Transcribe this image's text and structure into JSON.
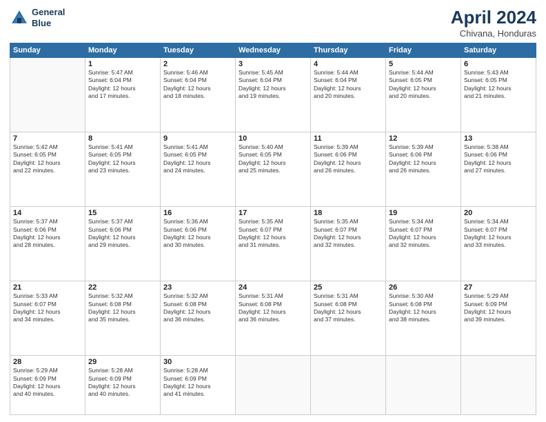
{
  "header": {
    "logo_line1": "General",
    "logo_line2": "Blue",
    "month": "April 2024",
    "location": "Chivana, Honduras"
  },
  "weekdays": [
    "Sunday",
    "Monday",
    "Tuesday",
    "Wednesday",
    "Thursday",
    "Friday",
    "Saturday"
  ],
  "weeks": [
    [
      {
        "day": "",
        "info": ""
      },
      {
        "day": "1",
        "info": "Sunrise: 5:47 AM\nSunset: 6:04 PM\nDaylight: 12 hours\nand 17 minutes."
      },
      {
        "day": "2",
        "info": "Sunrise: 5:46 AM\nSunset: 6:04 PM\nDaylight: 12 hours\nand 18 minutes."
      },
      {
        "day": "3",
        "info": "Sunrise: 5:45 AM\nSunset: 6:04 PM\nDaylight: 12 hours\nand 19 minutes."
      },
      {
        "day": "4",
        "info": "Sunrise: 5:44 AM\nSunset: 6:04 PM\nDaylight: 12 hours\nand 20 minutes."
      },
      {
        "day": "5",
        "info": "Sunrise: 5:44 AM\nSunset: 6:05 PM\nDaylight: 12 hours\nand 20 minutes."
      },
      {
        "day": "6",
        "info": "Sunrise: 5:43 AM\nSunset: 6:05 PM\nDaylight: 12 hours\nand 21 minutes."
      }
    ],
    [
      {
        "day": "7",
        "info": "Sunrise: 5:42 AM\nSunset: 6:05 PM\nDaylight: 12 hours\nand 22 minutes."
      },
      {
        "day": "8",
        "info": "Sunrise: 5:41 AM\nSunset: 6:05 PM\nDaylight: 12 hours\nand 23 minutes."
      },
      {
        "day": "9",
        "info": "Sunrise: 5:41 AM\nSunset: 6:05 PM\nDaylight: 12 hours\nand 24 minutes."
      },
      {
        "day": "10",
        "info": "Sunrise: 5:40 AM\nSunset: 6:05 PM\nDaylight: 12 hours\nand 25 minutes."
      },
      {
        "day": "11",
        "info": "Sunrise: 5:39 AM\nSunset: 6:06 PM\nDaylight: 12 hours\nand 26 minutes."
      },
      {
        "day": "12",
        "info": "Sunrise: 5:39 AM\nSunset: 6:06 PM\nDaylight: 12 hours\nand 26 minutes."
      },
      {
        "day": "13",
        "info": "Sunrise: 5:38 AM\nSunset: 6:06 PM\nDaylight: 12 hours\nand 27 minutes."
      }
    ],
    [
      {
        "day": "14",
        "info": "Sunrise: 5:37 AM\nSunset: 6:06 PM\nDaylight: 12 hours\nand 28 minutes."
      },
      {
        "day": "15",
        "info": "Sunrise: 5:37 AM\nSunset: 6:06 PM\nDaylight: 12 hours\nand 29 minutes."
      },
      {
        "day": "16",
        "info": "Sunrise: 5:36 AM\nSunset: 6:06 PM\nDaylight: 12 hours\nand 30 minutes."
      },
      {
        "day": "17",
        "info": "Sunrise: 5:35 AM\nSunset: 6:07 PM\nDaylight: 12 hours\nand 31 minutes."
      },
      {
        "day": "18",
        "info": "Sunrise: 5:35 AM\nSunset: 6:07 PM\nDaylight: 12 hours\nand 32 minutes."
      },
      {
        "day": "19",
        "info": "Sunrise: 5:34 AM\nSunset: 6:07 PM\nDaylight: 12 hours\nand 32 minutes."
      },
      {
        "day": "20",
        "info": "Sunrise: 5:34 AM\nSunset: 6:07 PM\nDaylight: 12 hours\nand 33 minutes."
      }
    ],
    [
      {
        "day": "21",
        "info": "Sunrise: 5:33 AM\nSunset: 6:07 PM\nDaylight: 12 hours\nand 34 minutes."
      },
      {
        "day": "22",
        "info": "Sunrise: 5:32 AM\nSunset: 6:08 PM\nDaylight: 12 hours\nand 35 minutes."
      },
      {
        "day": "23",
        "info": "Sunrise: 5:32 AM\nSunset: 6:08 PM\nDaylight: 12 hours\nand 36 minutes."
      },
      {
        "day": "24",
        "info": "Sunrise: 5:31 AM\nSunset: 6:08 PM\nDaylight: 12 hours\nand 36 minutes."
      },
      {
        "day": "25",
        "info": "Sunrise: 5:31 AM\nSunset: 6:08 PM\nDaylight: 12 hours\nand 37 minutes."
      },
      {
        "day": "26",
        "info": "Sunrise: 5:30 AM\nSunset: 6:08 PM\nDaylight: 12 hours\nand 38 minutes."
      },
      {
        "day": "27",
        "info": "Sunrise: 5:29 AM\nSunset: 6:09 PM\nDaylight: 12 hours\nand 39 minutes."
      }
    ],
    [
      {
        "day": "28",
        "info": "Sunrise: 5:29 AM\nSunset: 6:09 PM\nDaylight: 12 hours\nand 40 minutes."
      },
      {
        "day": "29",
        "info": "Sunrise: 5:28 AM\nSunset: 6:09 PM\nDaylight: 12 hours\nand 40 minutes."
      },
      {
        "day": "30",
        "info": "Sunrise: 5:28 AM\nSunset: 6:09 PM\nDaylight: 12 hours\nand 41 minutes."
      },
      {
        "day": "",
        "info": ""
      },
      {
        "day": "",
        "info": ""
      },
      {
        "day": "",
        "info": ""
      },
      {
        "day": "",
        "info": ""
      }
    ]
  ]
}
